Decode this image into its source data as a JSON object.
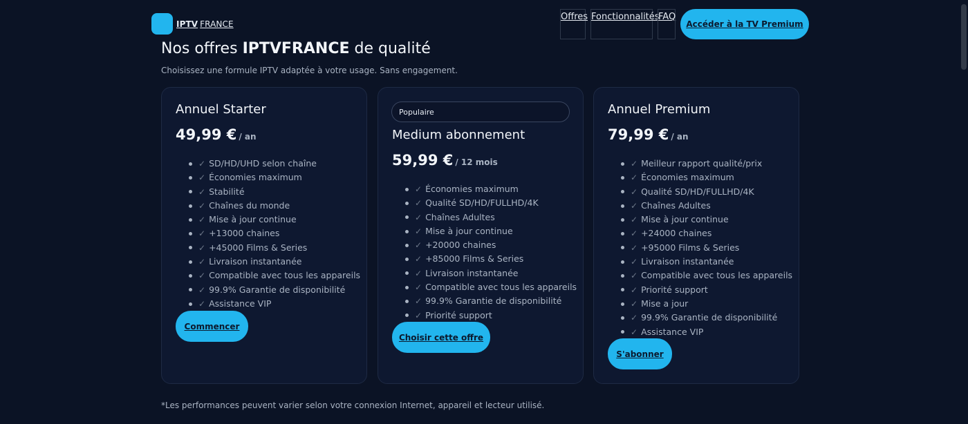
{
  "header": {
    "brand": {
      "name_bold": "IPTV",
      "name_rest": "FRANCE",
      "logo_icon": "brand-logo-square"
    },
    "nav": [
      {
        "label": "Offres"
      },
      {
        "label": "Fonctionnalités"
      },
      {
        "label": "FAQ"
      }
    ],
    "cta_label": "Accéder à la TV Premium"
  },
  "section": {
    "title_prefix": "Nos offres",
    "title_strong": "IPTVFRANCE",
    "title_suffix": "de qualité",
    "subtitle": "Choisissez une formule IPTV adaptée à votre usage. Sans engagement."
  },
  "plans": [
    {
      "title": "Annuel Starter",
      "price": "49,99 €",
      "period": "/ an",
      "button_label": "Commencer",
      "features": [
        "SD/HD/UHD selon chaîne",
        "Économies maximum",
        "Stabilité",
        "Chaînes du monde",
        "Mise à jour continue",
        "+13000 chaines",
        "+45000 Films & Series",
        "Livraison instantanée",
        "Compatible avec tous les appareils",
        "99.9% Garantie de disponibilité",
        "Assistance VIP"
      ]
    },
    {
      "badge": "Populaire",
      "title": "Medium abonnement",
      "price": "59,99 €",
      "period": "/ 12 mois",
      "button_label": "Choisir cette offre",
      "features": [
        "Économies maximum",
        "Qualité SD/HD/FULLHD/4K",
        "Chaînes Adultes",
        "Mise à jour continue",
        "+20000 chaines",
        "+85000 Films & Series",
        "Livraison instantanée",
        "Compatible avec tous les appareils",
        "99.9% Garantie de disponibilité",
        "Priorité support"
      ]
    },
    {
      "title": "Annuel Premium",
      "price": "79,99 €",
      "period": "/ an",
      "button_label": "S'abonner",
      "features": [
        "Meilleur rapport qualité/prix",
        "Économies maximum",
        "Qualité SD/HD/FULLHD/4K",
        "Chaînes Adultes",
        "Mise à jour continue",
        "+24000 chaines",
        "+95000 Films & Series",
        "Livraison instantanée",
        "Compatible avec tous les appareils",
        "Priorité support",
        "Mise a jour",
        "99.9% Garantie de disponibilité",
        "Assistance VIP"
      ]
    }
  ],
  "footnote": "*Les performances peuvent varier selon votre connexion Internet, appareil et lecteur utilisé.",
  "colors": {
    "background": "#0b1325",
    "card": "#0e1830",
    "accent": "#22b5ee",
    "text": "#e7ecf3",
    "muted": "#aab4c3"
  },
  "icons": {
    "feature_check": "check-icon",
    "feature_bullet": "bullet-dot"
  }
}
